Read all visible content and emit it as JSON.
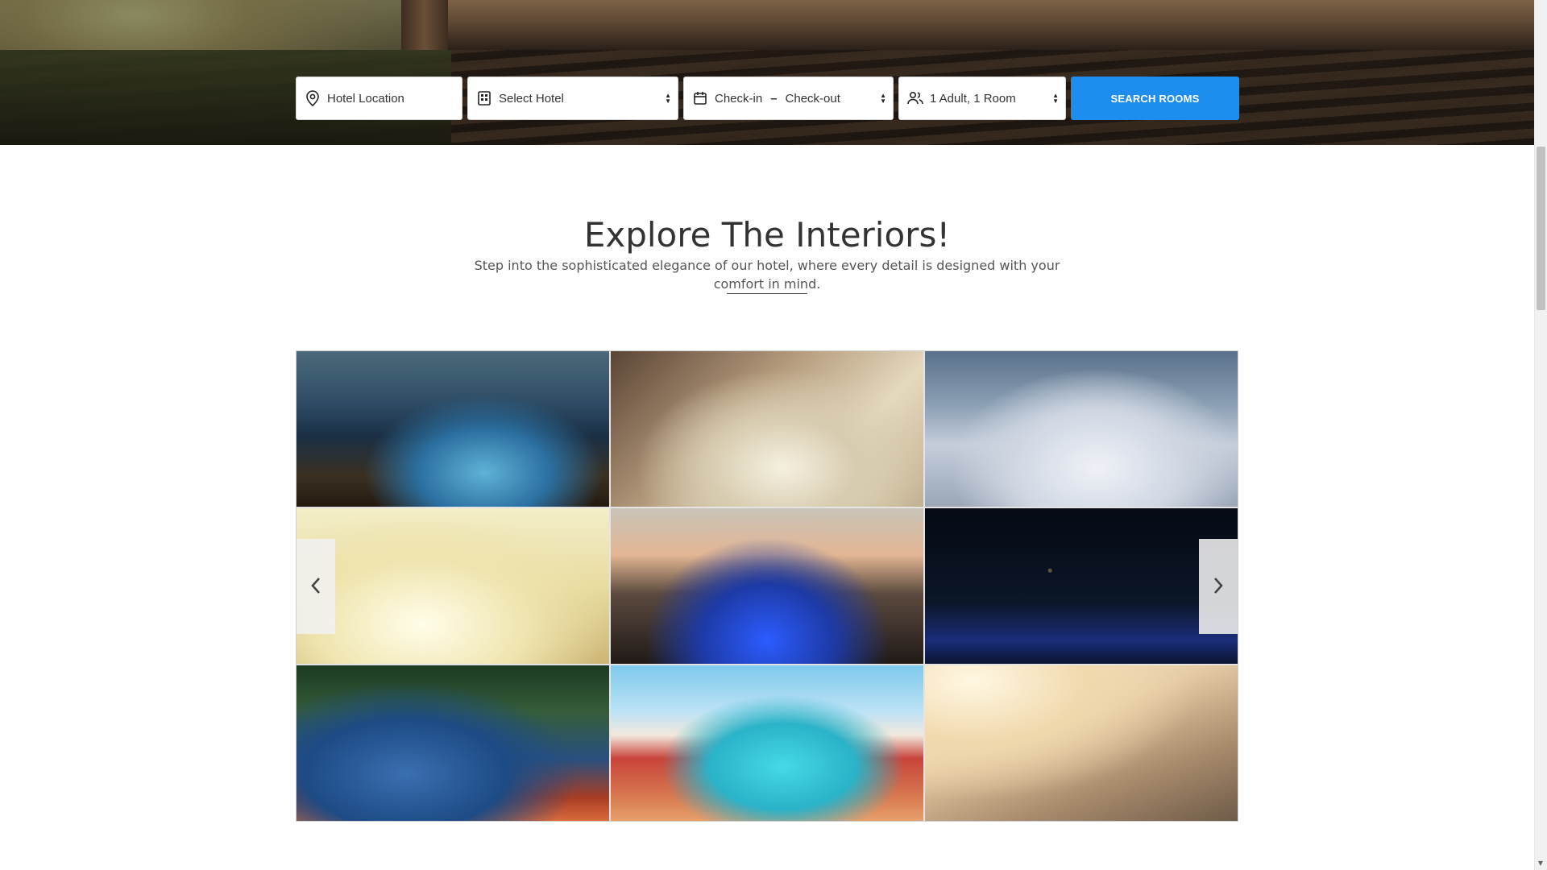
{
  "search": {
    "location_placeholder": "Hotel Location",
    "hotel_select": "Select Hotel",
    "check_in": "Check-in",
    "date_separator": "–",
    "check_out": "Check-out",
    "guests": "1 Adult, 1 Room",
    "button_label": "SEARCH ROOMS"
  },
  "section": {
    "title": "Explore The Interiors!",
    "description": "Step into the sophisticated elegance of our hotel, where every detail is designed with your comfort in mind."
  },
  "gallery": {
    "image_count": 9,
    "prev_icon": "chevron-left-icon",
    "next_icon": "chevron-right-icon"
  },
  "colors": {
    "accent": "#1d8ef0",
    "heading": "#333333",
    "text": "#555555"
  }
}
